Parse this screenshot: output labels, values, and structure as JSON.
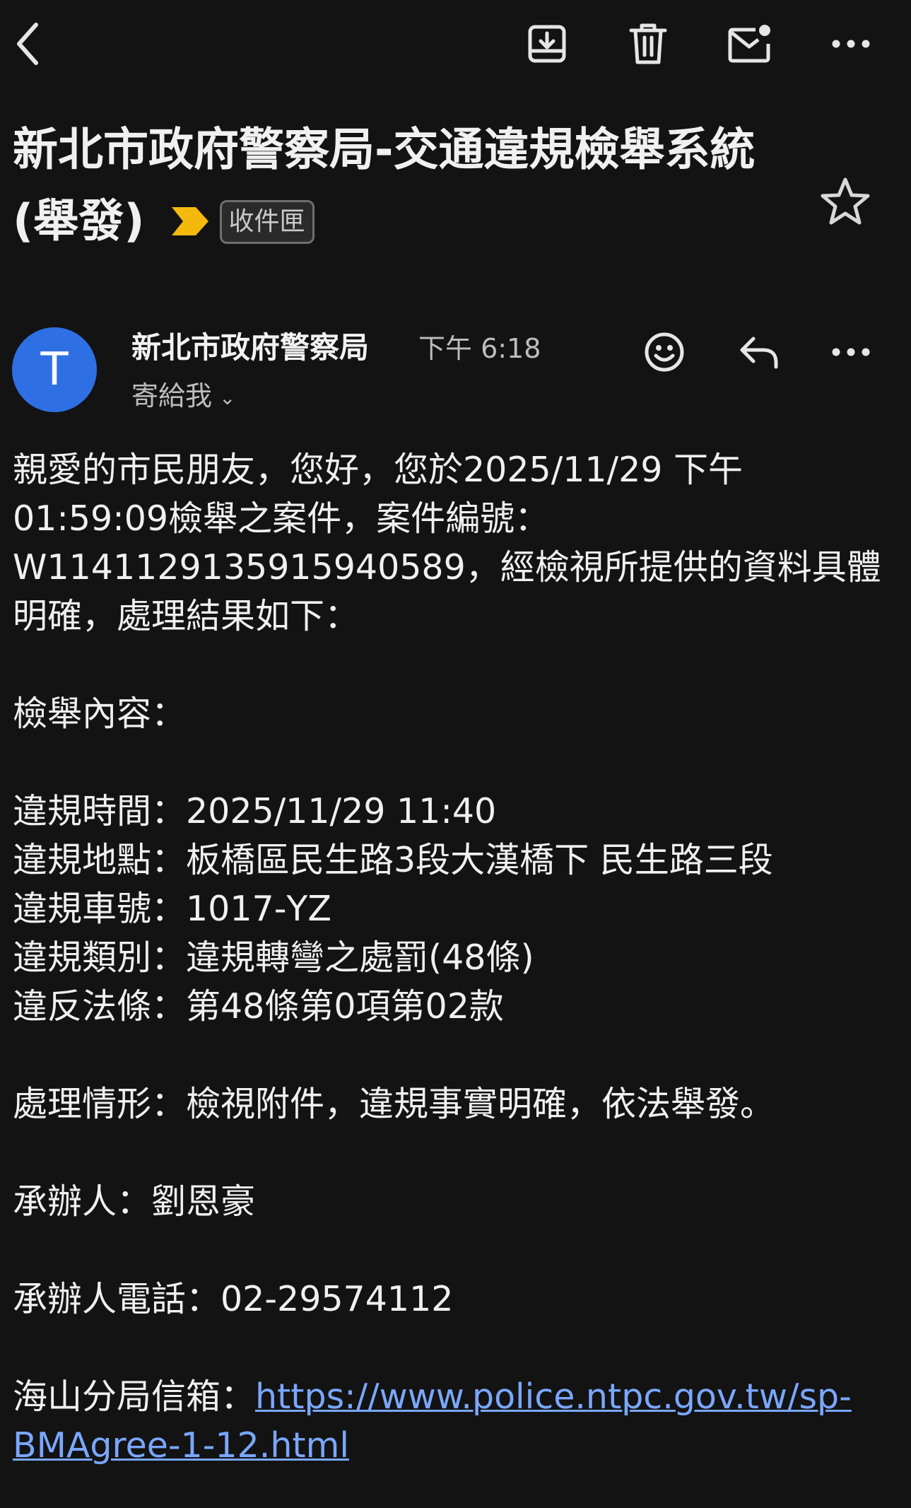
{
  "toolbar": {
    "back_icon": "chevron-left-icon",
    "archive_icon": "archive-icon",
    "delete_icon": "trash-icon",
    "mark_unread_icon": "mail-unread-icon",
    "more_icon": "more-horizontal-icon"
  },
  "subject": {
    "title": "新北市政府警察局-交通違規檢舉系統(舉發)",
    "label": "收件匣",
    "important_color": "#f5b90e"
  },
  "sender": {
    "avatar_letter": "T",
    "avatar_color": "#2f6fe4",
    "name": "新北市政府警察局",
    "time": "下午 6:18",
    "recipient": "寄給我",
    "recipient_chevron": "⌄"
  },
  "body": {
    "greeting": "親愛的市民朋友，您好，您於2025/11/29 下午01:59:09檢舉之案件，案件編號：W114112913591594058​9，經檢視所提供的資料具體明確，處理結果如下：",
    "content_heading": "檢舉內容：",
    "details": [
      "違規時間：2025/11/29 11:40",
      "違規地點：板橋區民生路3段大漢橋下 民生路三段",
      "違規車號：1017-YZ",
      "違規類別：違規轉彎之處罰(48條)",
      "違反法條：第48條第0項第02款"
    ],
    "status": "處理情形：檢視附件，違規事實明確，依法舉發。",
    "handler": "承辦人：劉恩豪",
    "handler_phone": "承辦人電話：02-29574112",
    "mailbox_label": "海山分局信箱：",
    "mailbox_url": "https://www.police.ntpc.gov.tw/sp-BMAgree-1-12.html"
  }
}
